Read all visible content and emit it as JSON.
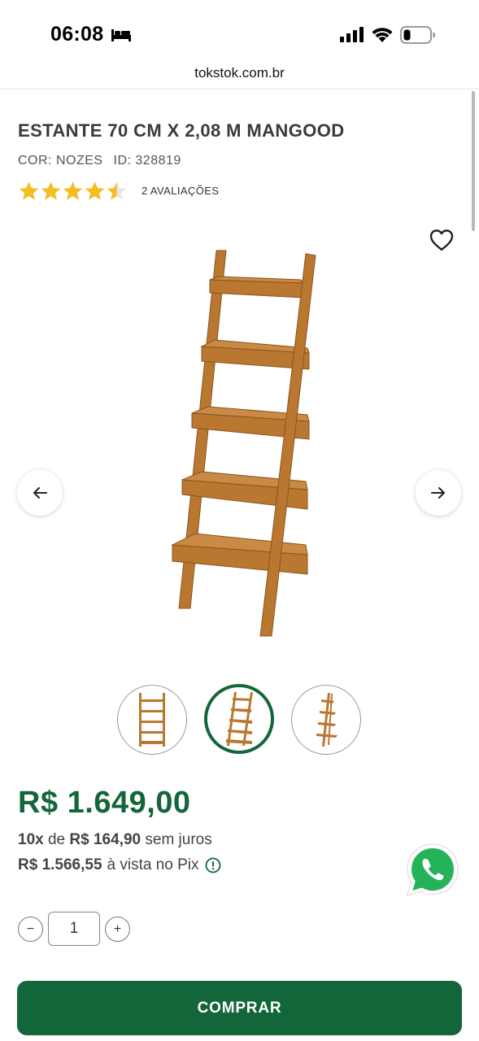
{
  "status_bar": {
    "time": "06:08",
    "icons": [
      "bed-icon",
      "signal-icon",
      "wifi-icon",
      "battery-icon"
    ]
  },
  "browser": {
    "url": "tokstok.com.br"
  },
  "product": {
    "title": "ESTANTE 70 CM X 2,08 M MANGOOD",
    "color_label": "COR: NOZES",
    "id_label": "ID: 328819",
    "rating": 4.5,
    "rating_max": 5,
    "reviews_label": "2 AVALIAÇÕES"
  },
  "gallery": {
    "thumbnail_count": 3,
    "active_thumbnail": 2
  },
  "pricing": {
    "price": "R$ 1.649,00",
    "installments_count": "10x",
    "installments_de": "de",
    "installment_value": "R$ 164,90",
    "installments_suffix": "sem juros",
    "pix_price": "R$ 1.566,55",
    "pix_suffix": "à vista no Pix"
  },
  "quantity": {
    "minus": "−",
    "value": "1",
    "plus": "+"
  },
  "actions": {
    "buy_label": "COMPRAR"
  },
  "colors": {
    "brand_green": "#13663a",
    "star_yellow": "#f5bd23",
    "wood": "#b9772f",
    "whatsapp_green": "#25b35a"
  }
}
